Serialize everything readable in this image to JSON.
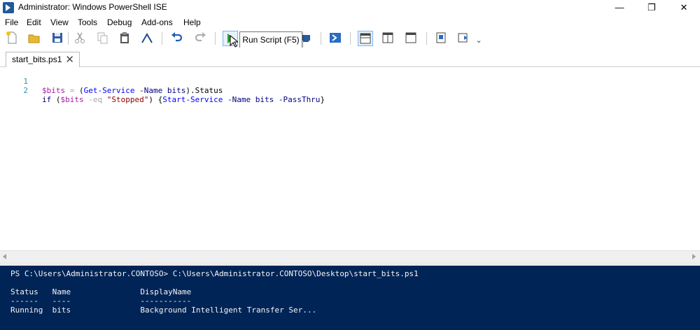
{
  "window": {
    "title": "Administrator: Windows PowerShell ISE",
    "minimize": "—",
    "restore": "❐",
    "close": "✕"
  },
  "menu": [
    "File",
    "Edit",
    "View",
    "Tools",
    "Debug",
    "Add-ons",
    "Help"
  ],
  "toolbar": {
    "tooltip": "Run Script (F5)",
    "more": "⌄"
  },
  "tabs": [
    {
      "label": "start_bits.ps1",
      "close": "✕"
    }
  ],
  "editor": {
    "lines": [
      {
        "num": "1",
        "tokens": [
          {
            "t": "$bits",
            "c": "var"
          },
          {
            "t": " = ",
            "c": "op"
          },
          {
            "t": "(",
            "c": "txt"
          },
          {
            "t": "Get-Service",
            "c": "cmd"
          },
          {
            "t": " ",
            "c": "txt"
          },
          {
            "t": "-Name",
            "c": "param"
          },
          {
            "t": " ",
            "c": "txt"
          },
          {
            "t": "bits",
            "c": "param"
          },
          {
            "t": ").Status",
            "c": "txt"
          }
        ]
      },
      {
        "num": "2",
        "tokens": [
          {
            "t": "if",
            "c": "param"
          },
          {
            "t": " (",
            "c": "txt"
          },
          {
            "t": "$bits",
            "c": "var"
          },
          {
            "t": " ",
            "c": "txt"
          },
          {
            "t": "-eq",
            "c": "op"
          },
          {
            "t": " ",
            "c": "txt"
          },
          {
            "t": "\"Stopped\"",
            "c": "str"
          },
          {
            "t": ") {",
            "c": "txt"
          },
          {
            "t": "Start-Service",
            "c": "cmd"
          },
          {
            "t": " ",
            "c": "txt"
          },
          {
            "t": "-Name",
            "c": "param"
          },
          {
            "t": " ",
            "c": "txt"
          },
          {
            "t": "bits",
            "c": "param"
          },
          {
            "t": " ",
            "c": "txt"
          },
          {
            "t": "-PassThru",
            "c": "param"
          },
          {
            "t": "}",
            "c": "txt"
          }
        ]
      }
    ]
  },
  "console": {
    "prompt_line": "PS C:\\Users\\Administrator.CONTOSO> C:\\Users\\Administrator.CONTOSO\\Desktop\\start_bits.ps1",
    "header": "Status   Name               DisplayName",
    "underline": "------   ----               -----------",
    "row": "Running  bits               Background Intelligent Transfer Ser..."
  },
  "colors": {
    "console_bg": "#012456",
    "variable": "#a61bab",
    "cmdlet": "#0000ff",
    "parameter": "#000080",
    "string": "#8b0000",
    "line_number": "#2b91af"
  }
}
